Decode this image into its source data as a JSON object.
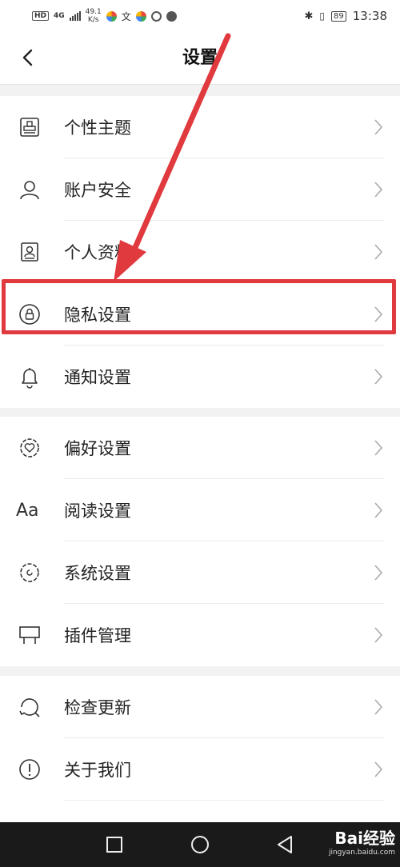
{
  "status_bar": {
    "net_tag": "HD",
    "net_type": "4G",
    "speed_value": "49.1",
    "speed_unit": "K/s",
    "battery": "89",
    "time": "13:38"
  },
  "header": {
    "title": "设置",
    "back_icon": "chevron-left-icon"
  },
  "groups": [
    {
      "items": [
        {
          "label": "个性主题",
          "icon": "theme-icon"
        },
        {
          "label": "账户安全",
          "icon": "user-icon"
        },
        {
          "label": "个人资料",
          "icon": "profile-card-icon"
        },
        {
          "label": "隐私设置",
          "icon": "lock-icon",
          "highlighted": true
        },
        {
          "label": "通知设置",
          "icon": "bell-icon"
        }
      ]
    },
    {
      "items": [
        {
          "label": "偏好设置",
          "icon": "heart-gear-icon"
        },
        {
          "label": "阅读设置",
          "icon": "font-aa-icon",
          "icon_text": "Aa"
        },
        {
          "label": "系统设置",
          "icon": "system-gear-icon"
        },
        {
          "label": "插件管理",
          "icon": "plugin-icon"
        }
      ]
    },
    {
      "items": [
        {
          "label": "检查更新",
          "icon": "refresh-search-icon"
        },
        {
          "label": "关于我们",
          "icon": "info-exclamation-icon"
        }
      ]
    }
  ],
  "annotation": {
    "color": "#e0393e"
  },
  "nav_bar": {
    "buttons": [
      "recent-apps-icon",
      "home-icon",
      "back-icon"
    ],
    "watermark_brand": "Bai经验",
    "watermark_url": "jingyan.baidu.com"
  }
}
